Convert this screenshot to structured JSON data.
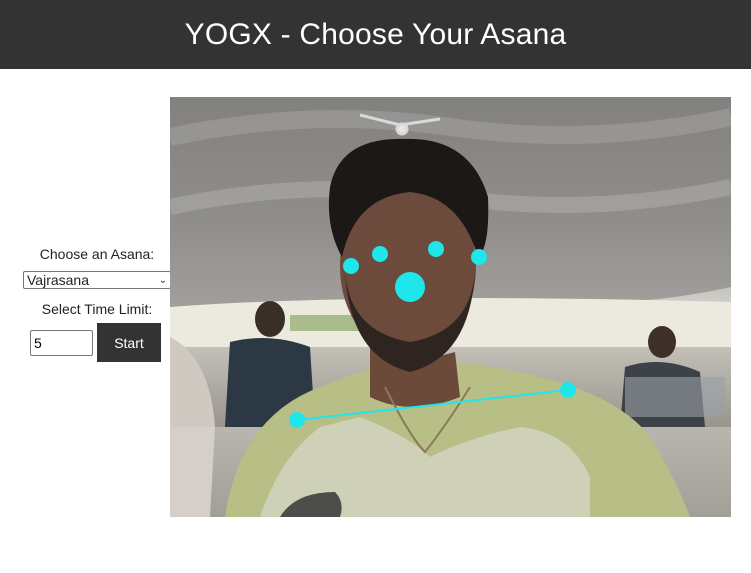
{
  "header": {
    "title": "YOGX - Choose Your Asana"
  },
  "controls": {
    "asana_label": "Choose an Asana:",
    "asana_selected": "Vajrasana",
    "time_label": "Select Time Limit:",
    "time_value": "5",
    "start_label": "Start"
  },
  "colors": {
    "header_bg": "#333333",
    "keypoint": "#1ee6ea",
    "button_bg": "#333333"
  },
  "video": {
    "description_icon": "webcam-feed",
    "keypoints": [
      "left-ear",
      "left-eye",
      "right-eye",
      "right-ear",
      "nose",
      "left-shoulder",
      "right-shoulder"
    ]
  }
}
